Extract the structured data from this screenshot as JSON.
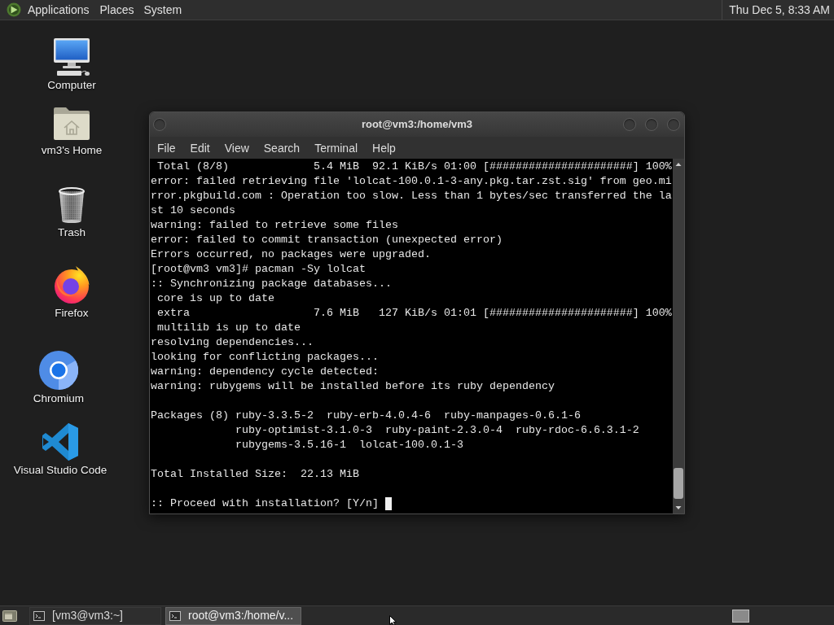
{
  "top_panel": {
    "menus": [
      "Applications",
      "Places",
      "System"
    ],
    "clock": "Thu Dec 5, 8:33 AM"
  },
  "desktop_icons": [
    {
      "label": "Computer",
      "kind": "computer"
    },
    {
      "label": "vm3's Home",
      "kind": "home"
    },
    {
      "label": "Trash",
      "kind": "trash"
    },
    {
      "label": "Firefox",
      "kind": "firefox"
    },
    {
      "label": "Chromium",
      "kind": "chromium"
    },
    {
      "label": "Visual Studio Code",
      "kind": "vscode"
    }
  ],
  "terminal_window": {
    "title": "root@vm3:/home/vm3",
    "menus": [
      "File",
      "Edit",
      "View",
      "Search",
      "Terminal",
      "Help"
    ],
    "output_blocks": [
      [
        " Total (8/8)             5.4 MiB  92.1 KiB/s 01:00 [######################] 100%",
        "error: failed retrieving file 'lolcat-100.0.1-3-any.pkg.tar.zst.sig' from geo.mi",
        "rror.pkgbuild.com : Operation too slow. Less than 1 bytes/sec transferred the la",
        "st 10 seconds",
        "warning: failed to retrieve some files",
        "error: failed to commit transaction (unexpected error)",
        "Errors occurred, no packages were upgraded.",
        "[root@vm3 vm3]# pacman -Sy lolcat",
        ":: Synchronizing package databases...",
        " core is up to date",
        " extra                   7.6 MiB   127 KiB/s 01:01 [######################] 100%",
        " multilib is up to date",
        "resolving dependencies...",
        "looking for conflicting packages...",
        "warning: dependency cycle detected:",
        "warning: rubygems will be installed before its ruby dependency"
      ],
      [
        "Packages (8) ruby-3.3.5-2  ruby-erb-4.0.4-6  ruby-manpages-0.6.1-6",
        "             ruby-optimist-3.1.0-3  ruby-paint-2.3.0-4  ruby-rdoc-6.6.3.1-2",
        "             rubygems-3.5.16-1  lolcat-100.0.1-3"
      ],
      [
        "Total Installed Size:  22.13 MiB"
      ]
    ],
    "prompt": ":: Proceed with installation? [Y/n]",
    "cursor": true
  },
  "taskbar": {
    "tasks": [
      {
        "label": "[vm3@vm3:~]",
        "selected": false
      },
      {
        "label": "root@vm3:/home/v...",
        "selected": true
      }
    ]
  }
}
